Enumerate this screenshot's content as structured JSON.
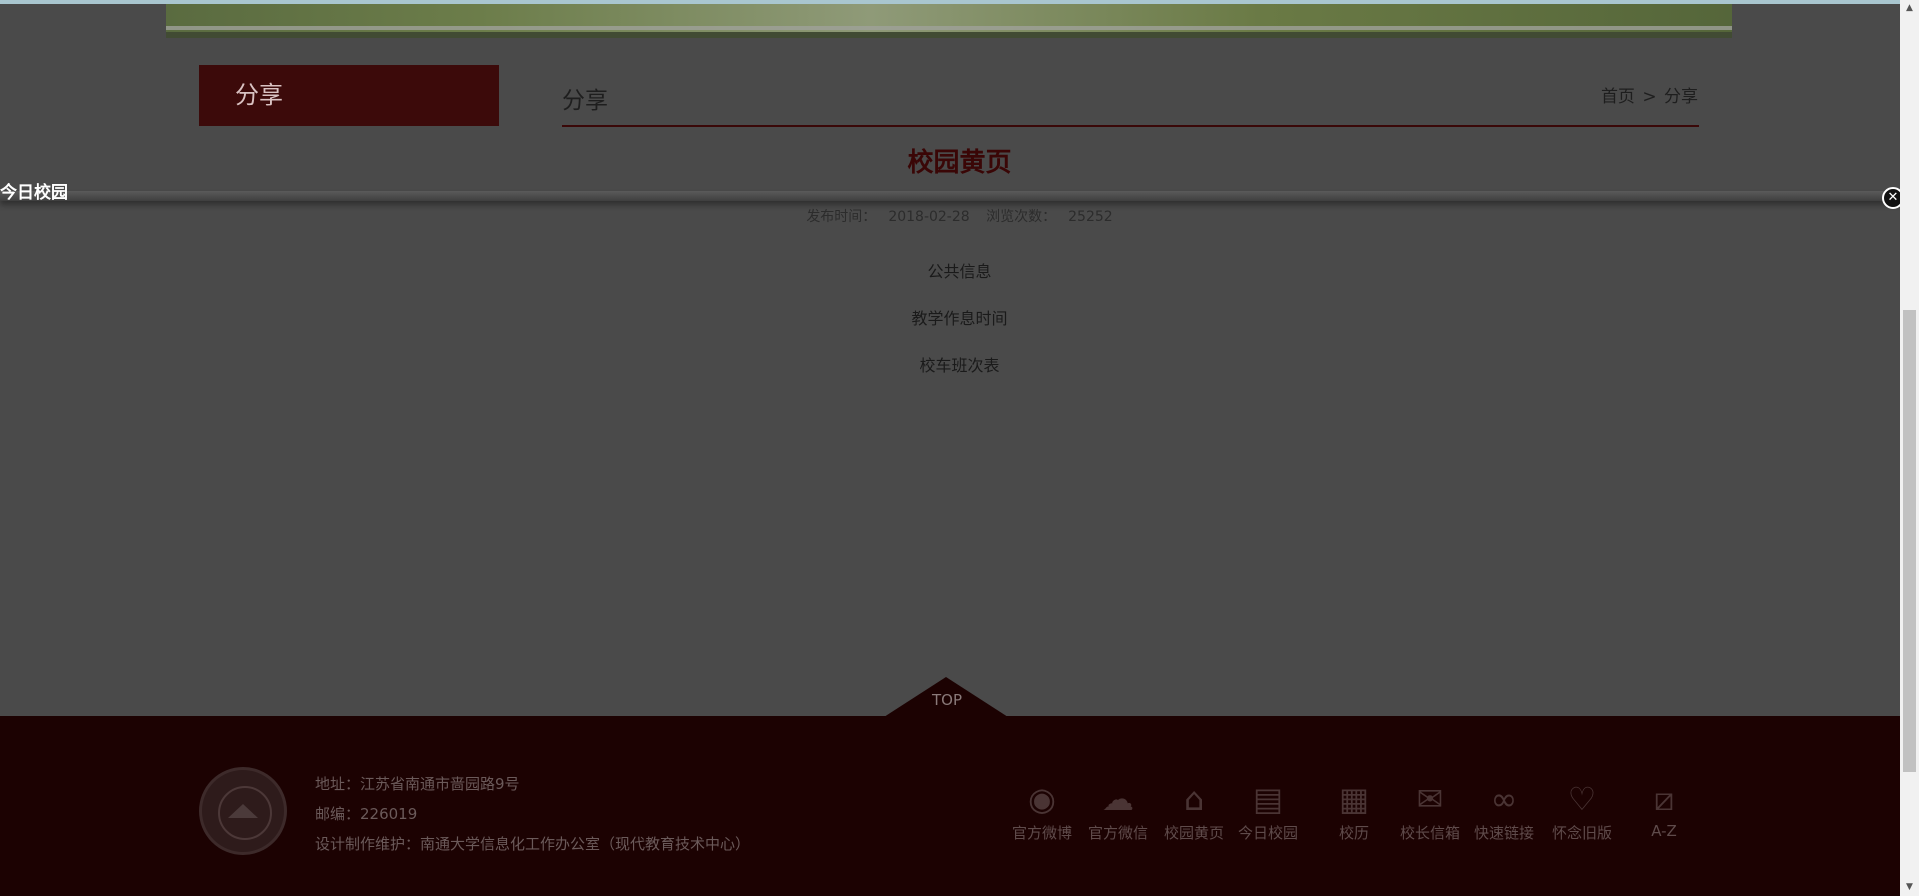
{
  "banner": {
    "image": "campus-banner-photo"
  },
  "sidebar": {
    "title": "分享"
  },
  "section": {
    "title": "分享"
  },
  "breadcrumb": {
    "home": "首页",
    "separator": ">",
    "current": "分享"
  },
  "article": {
    "title": "校园黄页",
    "published_label": "发布时间：",
    "published_date": "2018-02-28",
    "views_label": "浏览次数：",
    "views_count": "25252",
    "links": [
      "公共信息",
      "教学作息时间",
      "校车班次表"
    ]
  },
  "overlay": {
    "title": "今日校园",
    "close_icon": "close-icon"
  },
  "footer": {
    "top_label": "TOP",
    "address_line": "地址：江苏省南通市啬园路9号",
    "postcode_line": "邮编：226019",
    "credit_line": "设计制作维护：南通大学信息化工作办公室（现代教育技术中心）",
    "icons": [
      {
        "label": "官方微博",
        "icon": "weibo-icon"
      },
      {
        "label": "官方微信",
        "icon": "wechat-icon"
      },
      {
        "label": "校园黄页",
        "icon": "building-icon"
      },
      {
        "label": "今日校园",
        "icon": "newspaper-icon"
      },
      {
        "label": "校历",
        "icon": "calendar-icon"
      },
      {
        "label": "校长信箱",
        "icon": "mail-icon"
      },
      {
        "label": "快速链接",
        "icon": "link-icon"
      },
      {
        "label": "怀念旧版",
        "icon": "heart-icon"
      },
      {
        "label": "A-Z",
        "icon": "chart-icon"
      }
    ]
  },
  "colors": {
    "accent": "#3c0a0a",
    "footer": "#1c0202",
    "overlay": "#4a4a4a"
  }
}
